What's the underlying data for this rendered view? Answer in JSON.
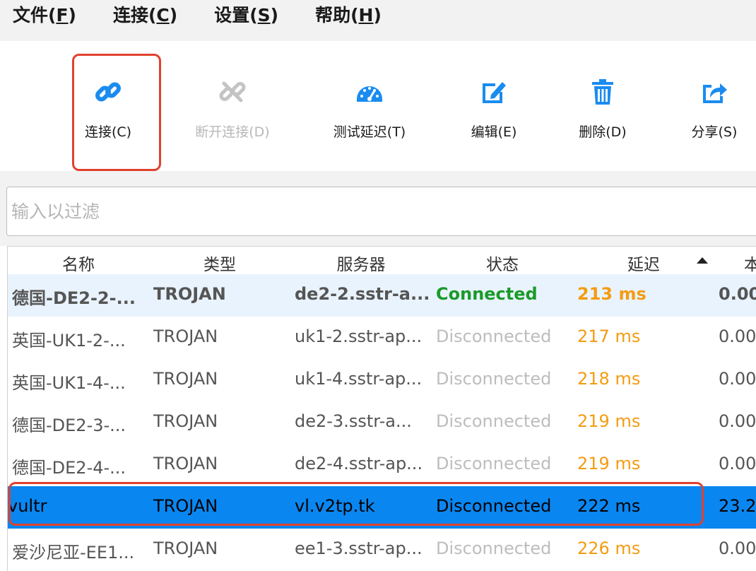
{
  "menu": {
    "file": {
      "text": "文件(",
      "key": "F",
      "end": ")"
    },
    "connect": {
      "text": "连接(",
      "key": "C",
      "end": ")"
    },
    "settings": {
      "text": "设置(",
      "key": "S",
      "end": ")"
    },
    "help": {
      "text": "帮助(",
      "key": "H",
      "end": ")"
    }
  },
  "toolbar": {
    "connect": "连接(C)",
    "disconnect": "断开连接(D)",
    "test_latency": "测试延迟(T)",
    "edit": "编辑(E)",
    "delete": "删除(D)",
    "share": "分享(S)"
  },
  "filter": {
    "placeholder": "输入以过滤",
    "value": ""
  },
  "table": {
    "columns": [
      "名称",
      "类型",
      "服务器",
      "状态",
      "延迟",
      "本"
    ],
    "rows": [
      {
        "name": "德国-DE2-2-...",
        "type": "TROJAN",
        "server": "de2-2.sstr-a...",
        "status": "Connected",
        "delay": "213 ms",
        "extra": "0.00"
      },
      {
        "name": "英国-UK1-2-...",
        "type": "TROJAN",
        "server": "uk1-2.sstr-ap...",
        "status": "Disconnected",
        "delay": "217 ms",
        "extra": "0.00"
      },
      {
        "name": "英国-UK1-4-...",
        "type": "TROJAN",
        "server": "uk1-4.sstr-ap...",
        "status": "Disconnected",
        "delay": "218 ms",
        "extra": "0.00"
      },
      {
        "name": "德国-DE2-3-...",
        "type": "TROJAN",
        "server": "de2-3.sstr-a...",
        "status": "Disconnected",
        "delay": "219 ms",
        "extra": "0.00"
      },
      {
        "name": "德国-DE2-4-...",
        "type": "TROJAN",
        "server": "de2-4.sstr-ap...",
        "status": "Disconnected",
        "delay": "219 ms",
        "extra": "0.00"
      },
      {
        "name": "vultr",
        "type": "TROJAN",
        "server": "vl.v2tp.tk",
        "status": "Disconnected",
        "delay": "222 ms",
        "extra": "23.2"
      },
      {
        "name": "爱沙尼亚-EE1...",
        "type": "TROJAN",
        "server": "ee1-3.sstr-ap...",
        "status": "Disconnected",
        "delay": "226 ms",
        "extra": "0.00"
      }
    ]
  },
  "colors": {
    "accent": "#0a86f0",
    "highlight": "#e0412e",
    "connected": "#1a9a2a",
    "latency": "#f39c12"
  }
}
